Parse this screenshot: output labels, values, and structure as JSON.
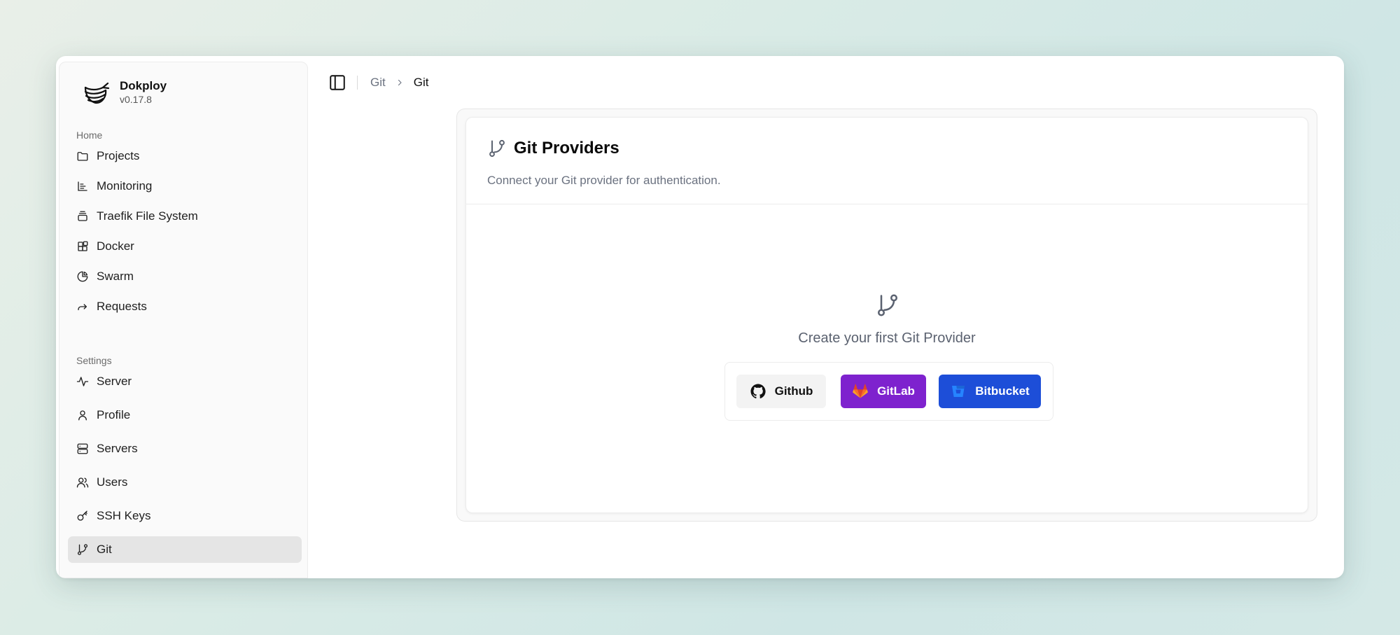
{
  "brand": {
    "name": "Dokploy",
    "version": "v0.17.8"
  },
  "sidebar": {
    "home_label": "Home",
    "settings_label": "Settings",
    "home_items": [
      {
        "label": "Projects",
        "icon": "folder-icon"
      },
      {
        "label": "Monitoring",
        "icon": "chart-icon"
      },
      {
        "label": "Traefik File System",
        "icon": "layers-icon"
      },
      {
        "label": "Docker",
        "icon": "blocks-icon"
      },
      {
        "label": "Swarm",
        "icon": "pie-chart-icon"
      },
      {
        "label": "Requests",
        "icon": "forward-icon"
      }
    ],
    "settings_items": [
      {
        "label": "Server",
        "icon": "activity-icon"
      },
      {
        "label": "Profile",
        "icon": "user-icon"
      },
      {
        "label": "Servers",
        "icon": "server-icon"
      },
      {
        "label": "Users",
        "icon": "users-icon"
      },
      {
        "label": "SSH Keys",
        "icon": "key-icon"
      },
      {
        "label": "Git",
        "icon": "git-branch-icon",
        "active": true
      }
    ]
  },
  "breadcrumb": {
    "parent": "Git",
    "current": "Git"
  },
  "git_providers": {
    "title": "Git Providers",
    "description": "Connect your Git provider for authentication.",
    "empty_text": "Create your first Git Provider",
    "buttons": {
      "github": "Github",
      "gitlab": "GitLab",
      "bitbucket": "Bitbucket"
    }
  },
  "colors": {
    "gitlab_button": "#7e22ce",
    "bitbucket_button": "#1d4ed8",
    "active_nav": "#e5e5e5"
  }
}
